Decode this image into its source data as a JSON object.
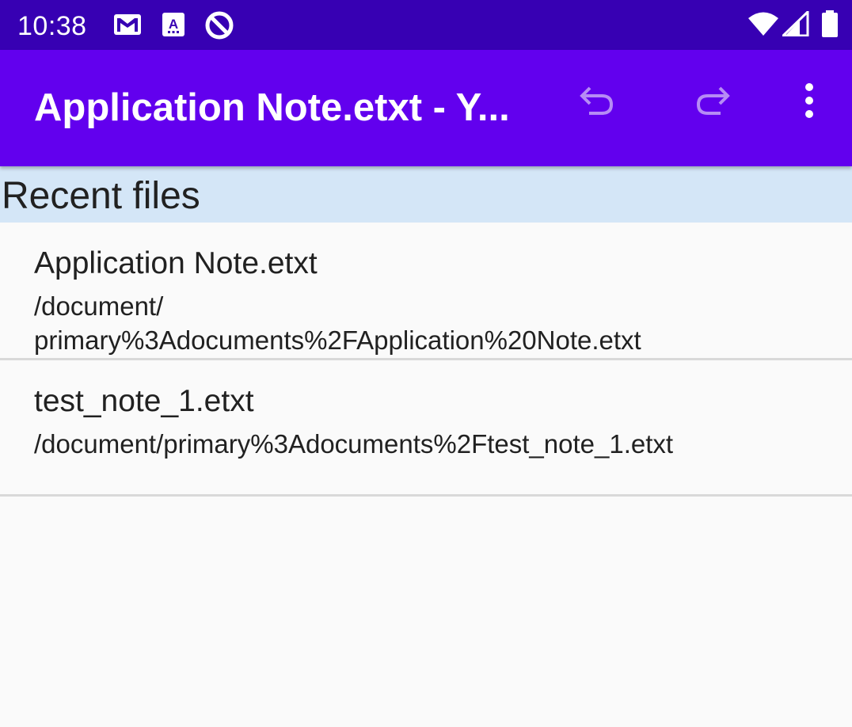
{
  "status_bar": {
    "time": "10:38",
    "left_icons": [
      "gmail-icon",
      "font-a-icon",
      "do-not-disturb-icon"
    ],
    "right_icons": [
      "wifi-icon",
      "cell-signal-icon",
      "battery-icon"
    ]
  },
  "app_bar": {
    "title": "Application Note.etxt - Y...",
    "actions": [
      "undo-icon",
      "redo-icon",
      "more-vert-icon"
    ],
    "background": "#6200ee",
    "status_bar_background": "#3700b3"
  },
  "recent": {
    "header": "Recent files",
    "header_background": "#d4e6f7",
    "items": [
      {
        "name": "Application Note.etxt",
        "path_line1": "/document/",
        "path_line2": "primary%3Adocuments%2FApplication%20Note.etxt"
      },
      {
        "name": "test_note_1.etxt",
        "path": "/document/primary%3Adocuments%2Ftest_note_1.etxt"
      }
    ]
  }
}
